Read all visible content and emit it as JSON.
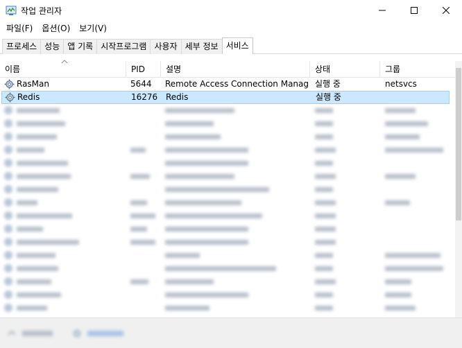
{
  "window": {
    "title": "작업 관리자"
  },
  "menu": [
    {
      "label": "파일(F)"
    },
    {
      "label": "옵션(O)"
    },
    {
      "label": "보기(V)"
    }
  ],
  "tabs": [
    {
      "label": "프로세스"
    },
    {
      "label": "성능"
    },
    {
      "label": "앱 기록"
    },
    {
      "label": "시작프로그램"
    },
    {
      "label": "사용자"
    },
    {
      "label": "세부 정보"
    },
    {
      "label": "서비스"
    }
  ],
  "active_tab_index": 6,
  "columns": [
    {
      "label": "이름"
    },
    {
      "label": "PID"
    },
    {
      "label": "설명"
    },
    {
      "label": "상태"
    },
    {
      "label": "그룹"
    }
  ],
  "rows": [
    {
      "name": "RasMan",
      "pid": "5644",
      "desc": "Remote Access Connection Manager",
      "status": "실행 중",
      "group": "netsvcs"
    },
    {
      "name": "Redis",
      "pid": "16276",
      "desc": "Redis",
      "status": "실행 중",
      "group": ""
    }
  ],
  "selected_row_index": 1,
  "colors": {
    "selected_bg": "#cce8ff",
    "selected_border": "#99d1ff"
  }
}
